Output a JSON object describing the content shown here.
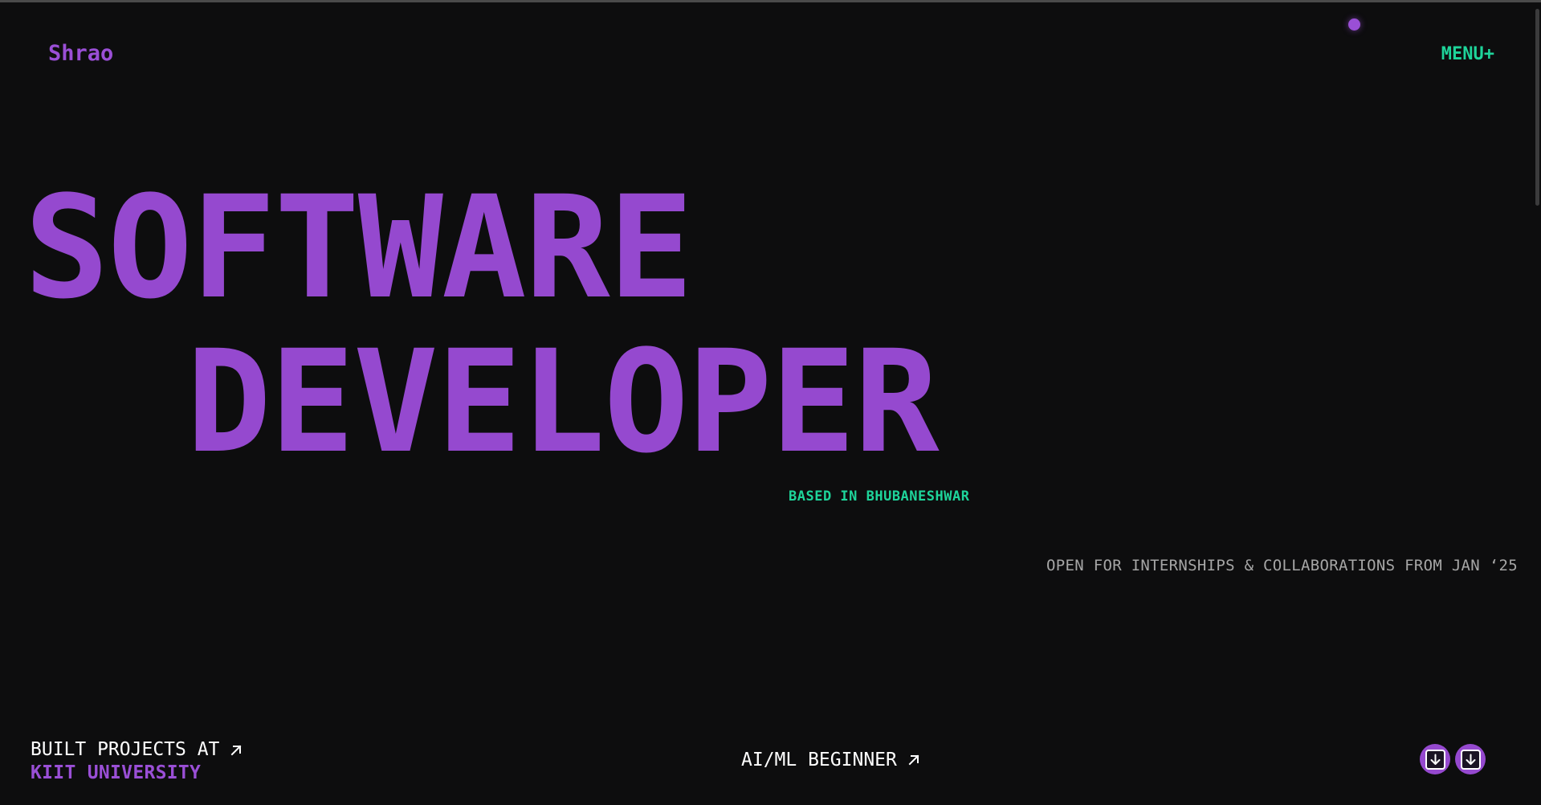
{
  "header": {
    "logo": "Shrao",
    "menu_label": "MENU+"
  },
  "hero": {
    "line1": "SOFTWARE",
    "line2": "DEVELOPER",
    "location": "BASED IN BHUBANESHWAR",
    "availability": "OPEN FOR INTERNSHIPS & COLLABORATIONS FROM JAN ‘25"
  },
  "footer": {
    "built_label": "BUILT PROJECTS AT",
    "university": "KIIT UNIVERSITY",
    "aiml_label": "AI/ML BEGINNER"
  },
  "icons": {
    "link_arrow": "arrow-up-right-icon",
    "scroll_down": "arrow-down-icon"
  },
  "colors": {
    "accent_purple": "#9549cf",
    "accent_green": "#1ed49a",
    "background": "#0d0d0e",
    "muted_text": "#a6a6a6"
  }
}
